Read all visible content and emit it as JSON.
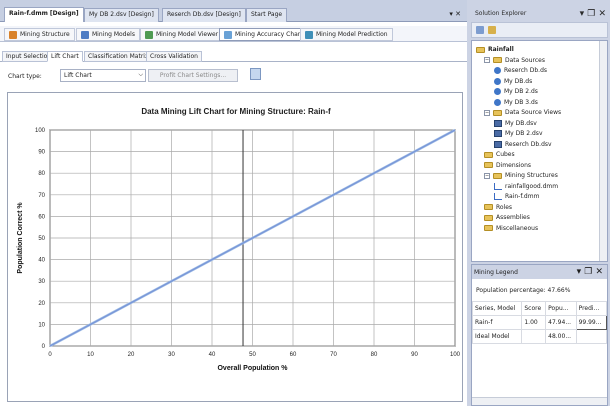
{
  "doc_tabs": [
    "Rain-f.dmm [Design]",
    "My DB 2.dsv [Design]",
    "Reserch Db.dsv [Design]",
    "Start Page"
  ],
  "doc_controls": "▾ ✕",
  "designer_tabs": [
    "Mining Structure",
    "Mining Models",
    "Mining Model Viewer",
    "Mining Accuracy Chart",
    "Mining Model Prediction"
  ],
  "inner_tabs": [
    "Input Selection",
    "Lift Chart",
    "Classification Matrix",
    "Cross Validation"
  ],
  "chart_type_label": "Chart type:",
  "chart_type_value": "Lift Chart",
  "profit_button": "Profit Chart Settings...",
  "chart_data": {
    "type": "line",
    "title": "Data Mining Lift Chart for Mining Structure: Rain-f",
    "xlabel": "Overall Population %",
    "ylabel": "Population Correct %",
    "xlim": [
      0,
      100
    ],
    "ylim": [
      0,
      100
    ],
    "x_ticks": [
      0,
      10,
      20,
      30,
      40,
      50,
      60,
      70,
      80,
      90,
      100
    ],
    "y_ticks": [
      0,
      10,
      20,
      30,
      40,
      50,
      60,
      70,
      80,
      90,
      100
    ],
    "grid": true,
    "marker_line_x": 47.66,
    "series": [
      {
        "points": [
          [
            0,
            0
          ],
          [
            100,
            100
          ]
        ],
        "color": "#a6c3e8"
      },
      {
        "points": [
          [
            0,
            0
          ],
          [
            100,
            100
          ]
        ],
        "color": "#7a97d8"
      }
    ]
  },
  "solution_explorer": {
    "title": "Solution Explorer",
    "controls": "▾ ❐ ✕",
    "tree": [
      {
        "label": "Rainfall",
        "depth": 0,
        "icon": "project",
        "bold": true
      },
      {
        "label": "Data Sources",
        "depth": 1,
        "icon": "folder",
        "expander": "−"
      },
      {
        "label": "Reserch Db.ds",
        "depth": 2,
        "icon": "ds"
      },
      {
        "label": "My DB.ds",
        "depth": 2,
        "icon": "ds"
      },
      {
        "label": "My DB 2.ds",
        "depth": 2,
        "icon": "ds"
      },
      {
        "label": "My DB 3.ds",
        "depth": 2,
        "icon": "ds"
      },
      {
        "label": "Data Source Views",
        "depth": 1,
        "icon": "folder",
        "expander": "−"
      },
      {
        "label": "My DB.dsv",
        "depth": 2,
        "icon": "dsv"
      },
      {
        "label": "My DB 2.dsv",
        "depth": 2,
        "icon": "dsv"
      },
      {
        "label": "Reserch Db.dsv",
        "depth": 2,
        "icon": "dsv"
      },
      {
        "label": "Cubes",
        "depth": 1,
        "icon": "folder"
      },
      {
        "label": "Dimensions",
        "depth": 1,
        "icon": "folder"
      },
      {
        "label": "Mining Structures",
        "depth": 1,
        "icon": "folder",
        "expander": "−"
      },
      {
        "label": "rainfallgood.dmm",
        "depth": 2,
        "icon": "mm"
      },
      {
        "label": "Rain-f.dmm",
        "depth": 2,
        "icon": "mm"
      },
      {
        "label": "Roles",
        "depth": 1,
        "icon": "folder"
      },
      {
        "label": "Assemblies",
        "depth": 1,
        "icon": "folder"
      },
      {
        "label": "Miscellaneous",
        "depth": 1,
        "icon": "folder"
      }
    ]
  },
  "mining_legend": {
    "title": "Mining Legend",
    "controls": "▾ ❐ ✕",
    "population": "Population percentage: 47.66%",
    "columns": [
      "Series, Model",
      "Score",
      "Popu...",
      "Predi..."
    ],
    "rows": [
      [
        "Rain-f",
        "1.00",
        "47.94...",
        "99.99..."
      ],
      [
        "Ideal Model",
        "",
        "48.00...",
        ""
      ]
    ]
  }
}
